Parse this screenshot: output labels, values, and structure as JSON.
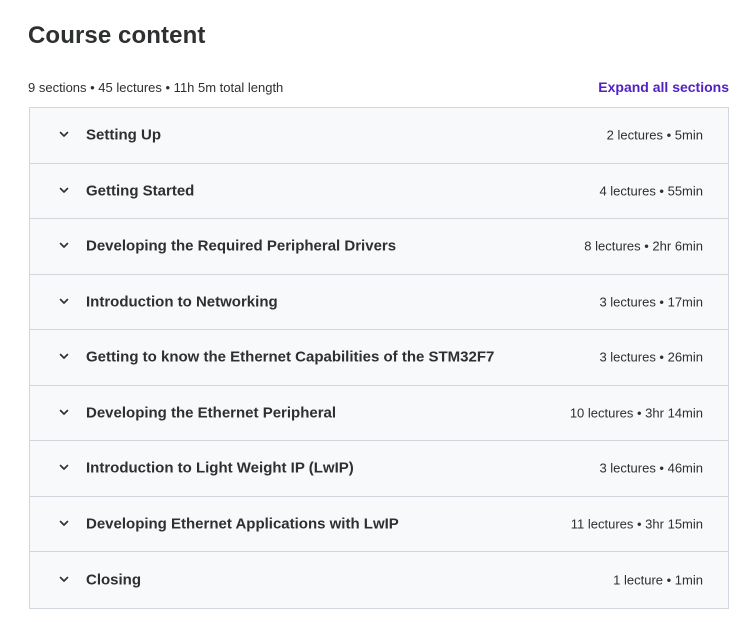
{
  "header": {
    "title": "Course content",
    "summary": "9 sections • 45 lectures • 11h 5m total length",
    "expand_label": "Expand all sections"
  },
  "colors": {
    "accent": "#5022c3",
    "row_bg": "#f7f9fa",
    "border": "#d1d7dc",
    "text": "#2d2f31"
  },
  "sections": [
    {
      "icon": "chevron-down-icon",
      "title": "Setting Up",
      "meta": "2 lectures • 5min"
    },
    {
      "icon": "chevron-down-icon",
      "title": "Getting Started",
      "meta": "4 lectures • 55min"
    },
    {
      "icon": "chevron-down-icon",
      "title": "Developing the Required Peripheral Drivers",
      "meta": "8 lectures • 2hr 6min"
    },
    {
      "icon": "chevron-down-icon",
      "title": "Introduction to Networking",
      "meta": "3 lectures • 17min"
    },
    {
      "icon": "chevron-down-icon",
      "title": "Getting to know the Ethernet Capabilities of the STM32F7",
      "meta": "3 lectures • 26min"
    },
    {
      "icon": "chevron-down-icon",
      "title": "Developing the Ethernet Peripheral",
      "meta": "10 lectures • 3hr 14min"
    },
    {
      "icon": "chevron-down-icon",
      "title": "Introduction to Light Weight IP (LwIP)",
      "meta": "3 lectures • 46min"
    },
    {
      "icon": "chevron-down-icon",
      "title": "Developing Ethernet Applications with LwIP",
      "meta": "11 lectures • 3hr 15min"
    },
    {
      "icon": "chevron-down-icon",
      "title": "Closing",
      "meta": "1 lecture • 1min"
    }
  ]
}
